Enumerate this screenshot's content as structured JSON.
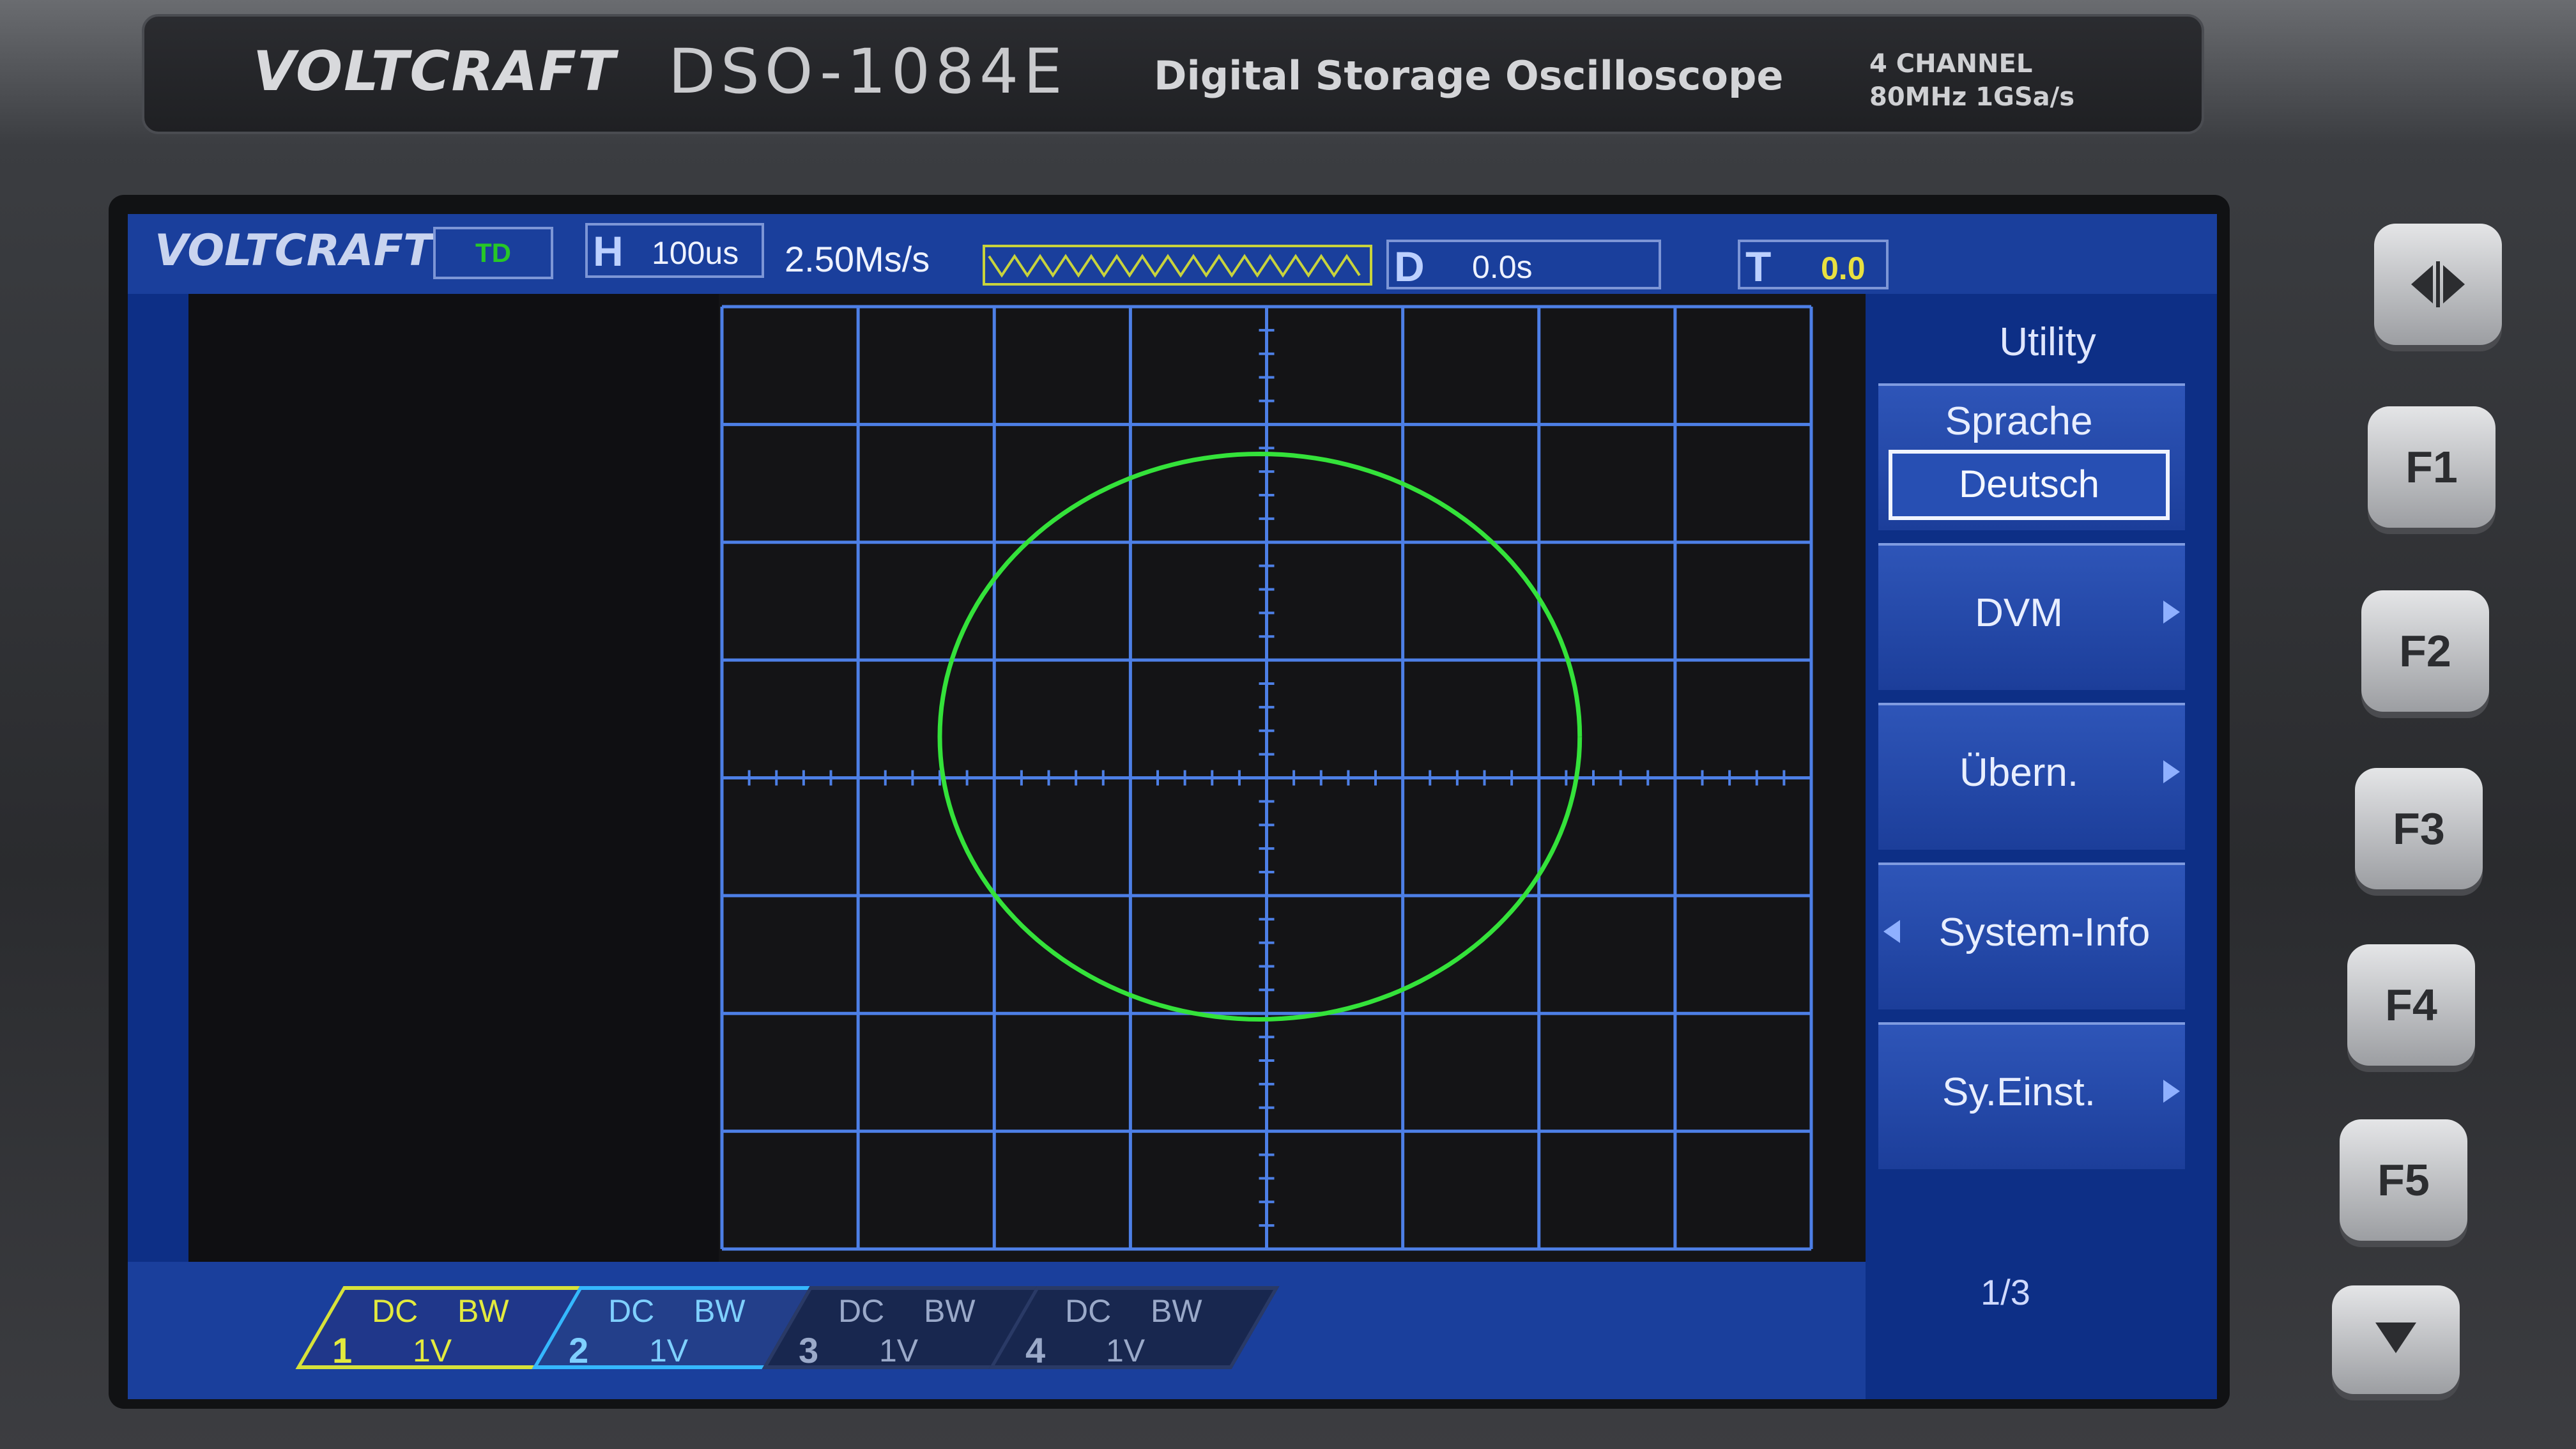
{
  "device": {
    "brand": "VOLTCRAFT",
    "model": "DSO-1084E",
    "description": "Digital Storage Oscilloscope",
    "spec_line1": "4 CHANNEL",
    "spec_line2": "80MHz 1GSa/s"
  },
  "status_bar": {
    "logo": "VOLTCRAFT",
    "trigger_status": "TD",
    "h_label": "H",
    "h_timebase": "100us",
    "sample_rate": "2.50Ms/s",
    "d_label": "D",
    "d_delay": "0.0s",
    "t_label": "T",
    "t_level": "0.0"
  },
  "menu": {
    "title": "Utility",
    "language_label": "Sprache",
    "language_value": "Deutsch",
    "dvm_label": "DVM",
    "transfer_label": "Übern.",
    "sysinfo_label": "System-Info",
    "sysconfig_label": "Sy.Einst.",
    "page": "1/3"
  },
  "channels": [
    {
      "num": "1",
      "coupling": "DC",
      "bw": "BW",
      "vdiv": "1V",
      "color": "#e3ea3e"
    },
    {
      "num": "2",
      "coupling": "DC",
      "bw": "BW",
      "vdiv": "1V",
      "color": "#7fd0ff"
    },
    {
      "num": "3",
      "coupling": "DC",
      "bw": "BW",
      "vdiv": "1V",
      "color": "#9aa9c9"
    },
    {
      "num": "4",
      "coupling": "DC",
      "bw": "BW",
      "vdiv": "1V",
      "color": "#9aa9c9"
    }
  ],
  "hw_buttons": {
    "f1": "F1",
    "f2": "F2",
    "f3": "F3",
    "f4": "F4",
    "f5": "F5",
    "top_icon": "split-arrows-icon",
    "bottom_icon": "down-triangle-icon"
  },
  "trace": {
    "mode": "XY",
    "color": "#34e23a",
    "center_x_div": -0.05,
    "center_y_div": 0.35,
    "radius_x_div": 2.35,
    "radius_y_div": 2.4
  },
  "colors": {
    "lcd_bg": "#0d2f86",
    "grid": "#4d7fe6",
    "trace": "#34e23a",
    "ch1": "#e3ea3e",
    "ch2": "#35b8ff"
  }
}
